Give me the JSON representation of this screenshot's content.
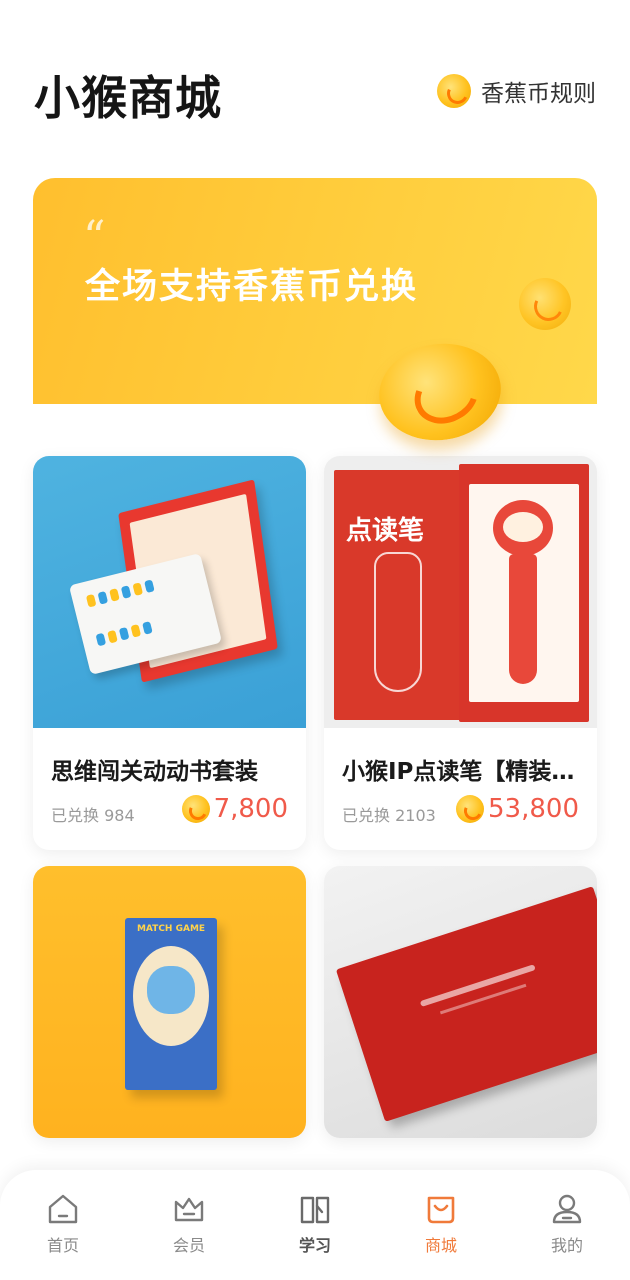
{
  "header": {
    "title": "小猴商城",
    "rules_label": "香蕉币规则"
  },
  "banner": {
    "text": "全场支持香蕉币兑换"
  },
  "products": [
    {
      "title": "思维闯关动动书套装",
      "exchanged_label": "已兑换",
      "exchanged_count": "984",
      "price": "7,800"
    },
    {
      "title": "小猴IP点读笔【精装礼盒】",
      "exchanged_label": "已兑换",
      "exchanged_count": "2103",
      "price": "53,800"
    },
    {
      "title": "",
      "exchanged_label": "",
      "exchanged_count": "",
      "price": ""
    },
    {
      "title": "",
      "exchanged_label": "",
      "exchanged_count": "",
      "price": ""
    }
  ],
  "product_images": {
    "pen_box_label": "点读笔",
    "game_box_label": "MATCH GAME"
  },
  "nav": {
    "items": [
      {
        "label": "首页"
      },
      {
        "label": "会员"
      },
      {
        "label": "学习"
      },
      {
        "label": "商城"
      },
      {
        "label": "我的"
      }
    ],
    "active_index": 3
  },
  "colors": {
    "accent": "#f07a3a",
    "price": "#f05a4a",
    "banner": "#ffc730"
  }
}
